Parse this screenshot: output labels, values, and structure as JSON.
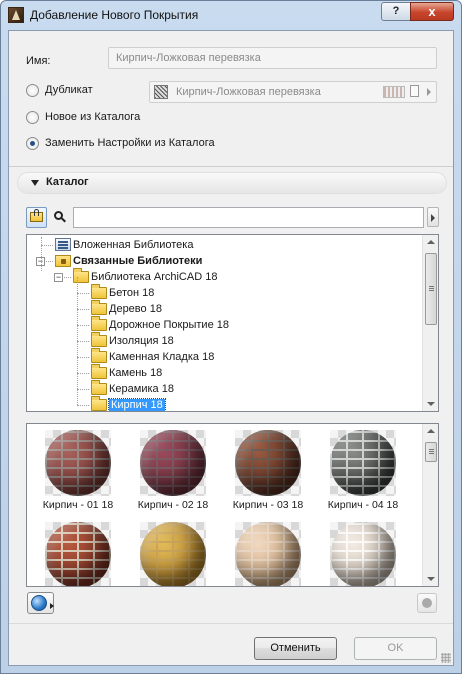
{
  "window": {
    "title": "Добавление Нового Покрытия",
    "help_label": "?",
    "close_label": "x"
  },
  "name_row": {
    "label": "Имя:",
    "value": "Кирпич-Ложковая перевязка"
  },
  "options": {
    "duplicate_label": "Дубликат",
    "duplicate_value": "Кирпич-Ложковая перевязка",
    "new_from_catalog_label": "Новое из Каталога",
    "replace_label": "Заменить Настройки из Каталога",
    "selected": "replace"
  },
  "catalog": {
    "header": "Каталог",
    "search_value": ""
  },
  "tree": [
    {
      "label": "Вложенная Библиотека",
      "icon": "embedded-library-icon",
      "level": 0
    },
    {
      "label": "Связанные Библиотеки",
      "icon": "linked-libraries-folder-icon",
      "level": 0,
      "bold": true,
      "expanded": true
    },
    {
      "label": "Библиотека ArchiCAD 18",
      "icon": "folder-icon",
      "level": 1,
      "expanded": true
    },
    {
      "label": "Бетон 18",
      "icon": "folder-icon",
      "level": 2
    },
    {
      "label": "Дерево 18",
      "icon": "folder-icon",
      "level": 2
    },
    {
      "label": "Дорожное Покрытие 18",
      "icon": "folder-icon",
      "level": 2
    },
    {
      "label": "Изоляция 18",
      "icon": "folder-icon",
      "level": 2
    },
    {
      "label": "Каменная Кладка 18",
      "icon": "folder-icon",
      "level": 2
    },
    {
      "label": "Камень 18",
      "icon": "folder-icon",
      "level": 2
    },
    {
      "label": "Керамика 18",
      "icon": "folder-icon",
      "level": 2
    },
    {
      "label": "Кирпич 18",
      "icon": "folder-icon",
      "level": 2,
      "selected": true
    }
  ],
  "gallery": [
    {
      "label": "Кирпич - 01 18",
      "color_a": "#7a3a36",
      "color_b": "#a9625c",
      "mortar": "#9b8b86"
    },
    {
      "label": "Кирпич - 02 18",
      "color_a": "#6b2f3a",
      "color_b": "#9b4a5c",
      "mortar": "#7a5b64"
    },
    {
      "label": "Кирпич - 03 18",
      "color_a": "#5a2f22",
      "color_b": "#9a5a40",
      "mortar": "#6a5a50"
    },
    {
      "label": "Кирпич - 04 18",
      "color_a": "#3e4240",
      "color_b": "#8a8e8a",
      "mortar": "#cfd2cf"
    },
    {
      "label": "",
      "color_a": "#7e3324",
      "color_b": "#b85a40",
      "mortar": "#d9c9b6"
    },
    {
      "label": "",
      "color_a": "#b8862a",
      "color_b": "#e2bc5a",
      "mortar": "#c9a35a"
    },
    {
      "label": "",
      "color_a": "#c7a27a",
      "color_b": "#f2d9bf",
      "mortar": "#ead6c2"
    },
    {
      "label": "",
      "color_a": "#c9bcae",
      "color_b": "#f3ece4",
      "mortar": "#fbfaf8"
    }
  ],
  "footer": {
    "cancel_label": "Отменить",
    "ok_label": "OK"
  }
}
